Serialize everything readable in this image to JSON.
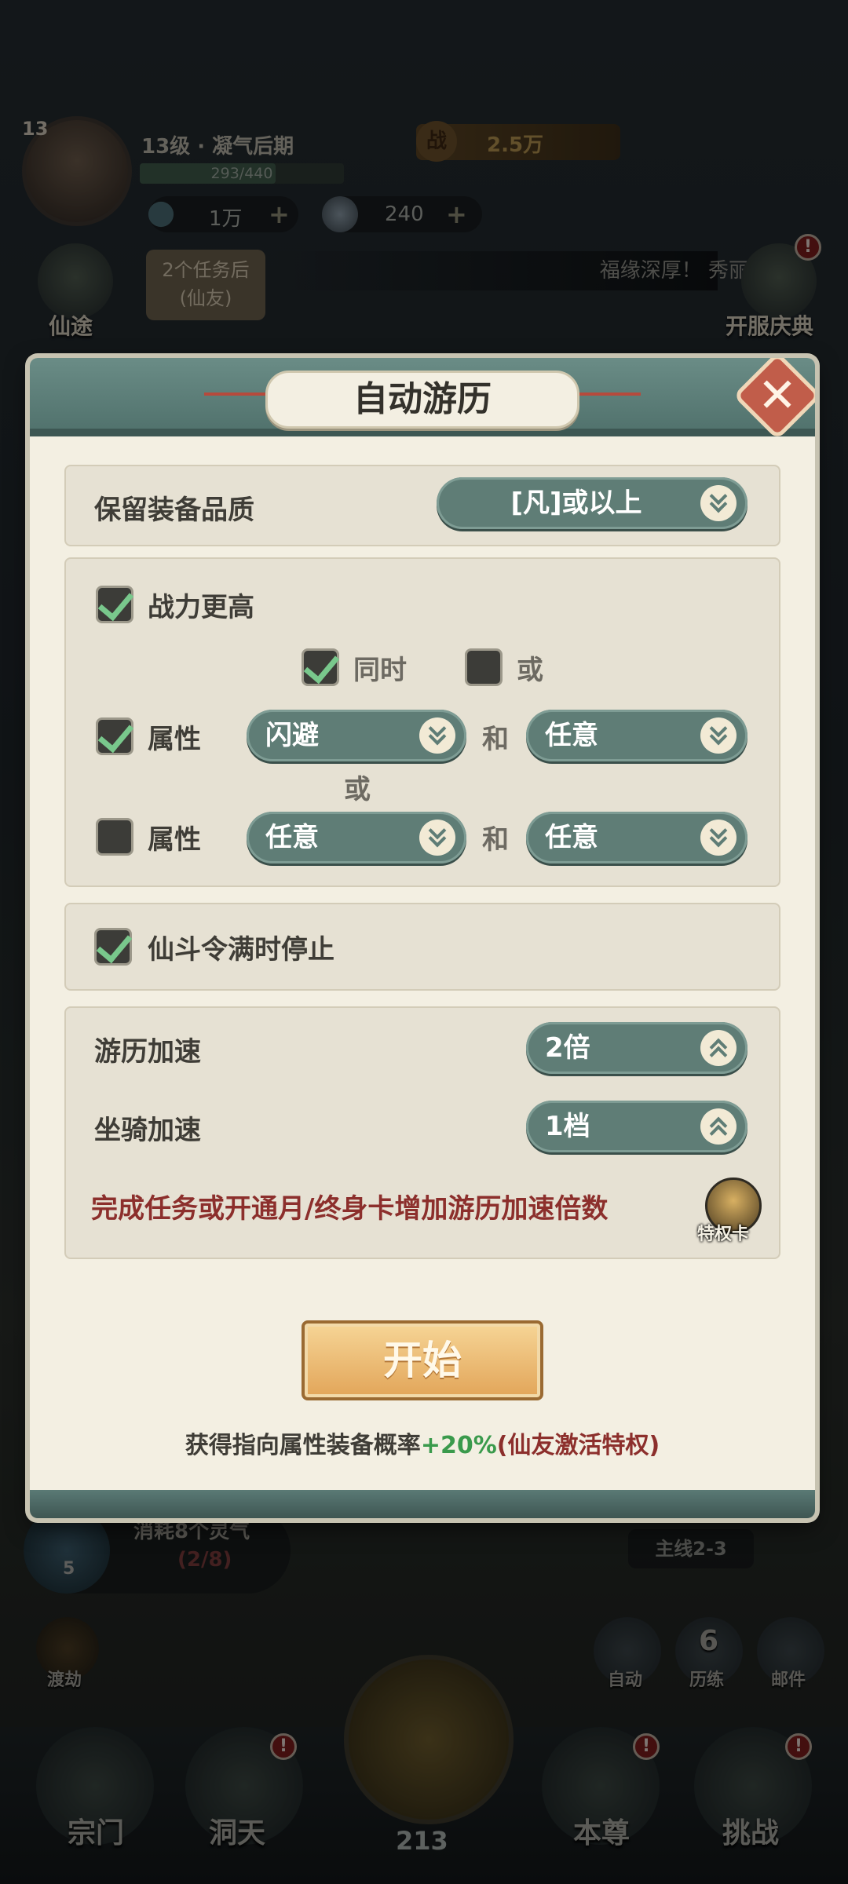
{
  "player": {
    "level": "13",
    "title": "13级 · 凝气后期",
    "exp_text": "293/440",
    "exp_progress": 0.666,
    "power_icon_text": "战",
    "power_value": "2.5万",
    "spirit_stone": "1万",
    "jade": "240"
  },
  "side": {
    "xiantu_label": "仙途",
    "task_tip_line1": "2个任务后",
    "task_tip_line2": "(仙友)",
    "marquee": "福缘深厚！ 秀丽无",
    "celebration_label": "开服庆典",
    "celebration_badge": "!"
  },
  "modal": {
    "title": "自动游历",
    "close_symbol": "✕",
    "quality_label": "保留装备品质",
    "quality_value": "[凡]或以上",
    "power_higher_label": "战力更高",
    "power_higher_checked": true,
    "simultaneous_label": "同时",
    "simultaneous_checked": true,
    "or_label": "或",
    "or_checked": false,
    "attr_row1": {
      "label": "属性",
      "checked": true,
      "first": "闪避",
      "and": "和",
      "second": "任意"
    },
    "between_or": "或",
    "attr_row2": {
      "label": "属性",
      "checked": false,
      "first": "任意",
      "and": "和",
      "second": "任意"
    },
    "stop_label": "仙斗令满时停止",
    "stop_checked": true,
    "travel_speed_label": "游历加速",
    "travel_speed_value": "2倍",
    "mount_speed_label": "坐骑加速",
    "mount_speed_value": "1档",
    "hint": "完成任务或开通月/终身卡增加游历加速倍数",
    "privilege_label": "特权卡",
    "start_button": "开始",
    "bonus_prefix": "获得指向属性装备概率",
    "bonus_value": "+20%",
    "bonus_suffix": "(仙友激活特权)"
  },
  "bottom": {
    "task_count": "5",
    "task_text": "消耗8个灵气",
    "task_progress": "(2/8)",
    "mainline": "主线2-3",
    "dujie": "渡劫",
    "auto": "自动",
    "training_count": "6",
    "training": "历练",
    "mail": "邮件",
    "nav": [
      "宗门",
      "洞天",
      "本尊",
      "挑战"
    ],
    "center_count": "213"
  },
  "colors": {
    "teal": "#5f7d76",
    "panel": "#f3efe2",
    "red_hint": "#8c2f2c",
    "green_bonus": "#3a9a4c",
    "start_gold": "#e2a559"
  }
}
